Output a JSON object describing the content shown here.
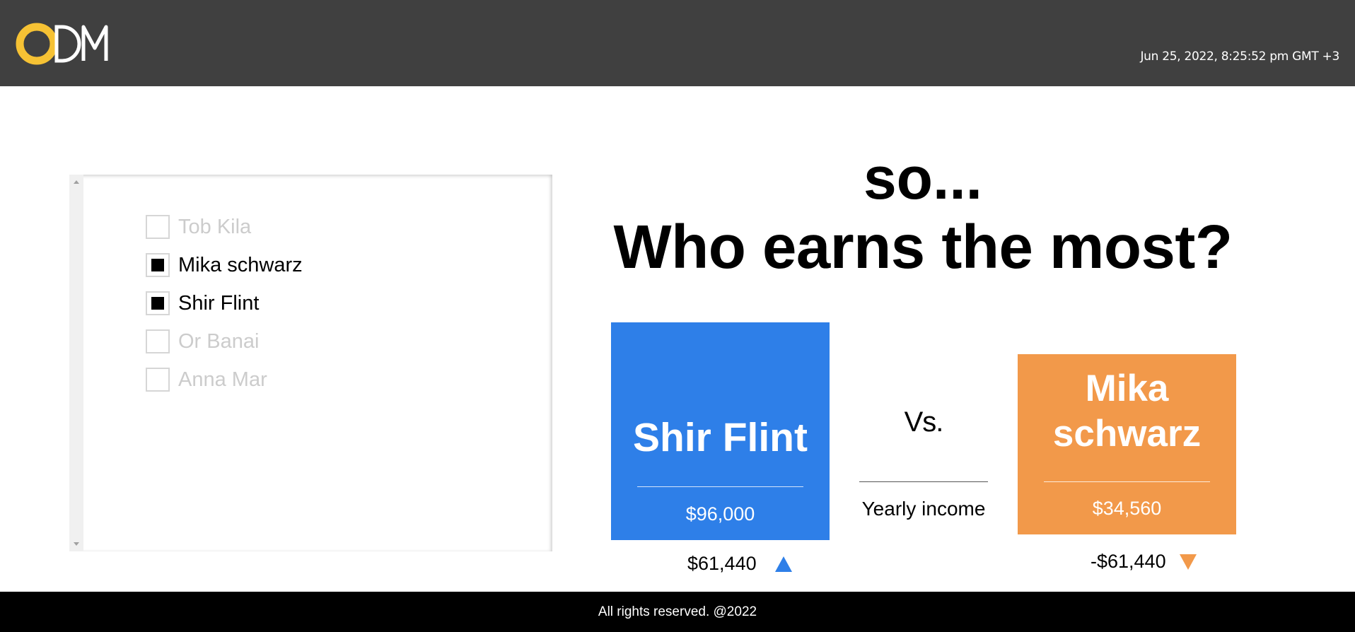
{
  "header": {
    "logo_text": "CDM",
    "datetime": "Jun 25, 2022, 8:25:52 pm GMT +3",
    "colors": {
      "background": "#404040",
      "logo_accent": "#f6c234"
    }
  },
  "employee_list": {
    "items": [
      {
        "label": "Tob Kila",
        "checked": false
      },
      {
        "label": "Mika schwarz",
        "checked": true
      },
      {
        "label": "Shir Flint",
        "checked": true
      },
      {
        "label": "Or Banai",
        "checked": false
      },
      {
        "label": "Anna Mar",
        "checked": false
      }
    ]
  },
  "comparison": {
    "intro": "so...",
    "question": "Who earns the most?",
    "vs_label": "Vs.",
    "metric_label": "Yearly income",
    "left": {
      "name": "Shir Flint",
      "value": "$96,000",
      "difference": "$61,440",
      "trend": "up",
      "color": "#2e7fe8"
    },
    "right": {
      "name_line1": "Mika",
      "name_line2": "schwarz",
      "value": "$34,560",
      "difference": "-$61,440",
      "trend": "down",
      "color": "#f2994a"
    }
  },
  "footer": {
    "text": "All rights reserved. @2022"
  }
}
